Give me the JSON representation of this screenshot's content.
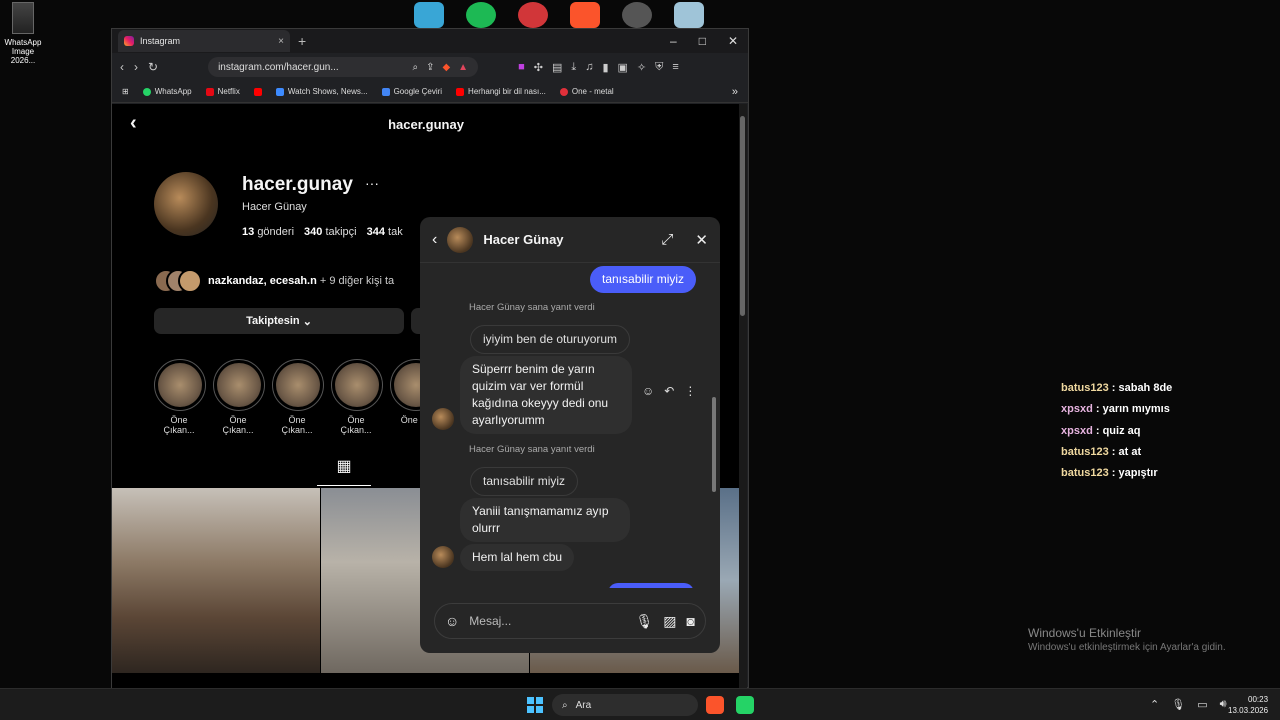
{
  "desktop": {
    "icon_label": "WhatsApp Image 2026..."
  },
  "browser": {
    "tab_title": "Instagram",
    "tab_close": "×",
    "new_tab": "+",
    "win_min": "–",
    "win_max": "□",
    "win_close": "✕",
    "url": "instagram.com/hacer.gun...",
    "bookmarks": [
      "WhatsApp",
      "Netflix",
      "Watch Shows, News...",
      "Google Çeviri",
      "Herhangi bir dil nası...",
      "One - metal"
    ],
    "bookmark_more": "»"
  },
  "profile": {
    "header_title": "hacer.gunay",
    "username": "hacer.gunay",
    "more": "···",
    "full_name": "Hacer Günay",
    "posts_count": "13",
    "posts_label": "gönderi",
    "followers_count": "340",
    "followers_label": "takipçi",
    "following_count": "344",
    "following_label": "tak",
    "followed_by_names": "nazkandaz, ecesah.n",
    "followed_by_rest": "+ 9 diğer kişi ta",
    "follow_button": "Takiptesin",
    "highlights": [
      "Öne Çıkan...",
      "Öne Çıkan...",
      "Öne Çıkan...",
      "Öne Çıkan...",
      "Öne Çı"
    ]
  },
  "chat": {
    "contact_name": "Hacer Günay",
    "messages": {
      "m1": "tanısabilir miyiz",
      "reply_meta_1": "Hacer Günay sana yanıt verdi",
      "quoted_1": "iyiyim ben de oturuyorum",
      "m2": "Süperrr benim de yarın quizim var ver formül kağıdına okeyyy dedi onu ayarlıyorumm",
      "reply_meta_2": "Hacer Günay sana yanıt verdi",
      "quoted_2": "tanısabilir miyiz",
      "m3": "Yaniii tanışmamamız ayıp olurrr",
      "m4": "Hem lal hem cbu"
    },
    "composer_placeholder": "Mesaj..."
  },
  "stream_chat": [
    {
      "user": "batus123",
      "text": "sabah 8de"
    },
    {
      "user": "xpsxd",
      "text": "yarın mıymıs"
    },
    {
      "user": "xpsxd",
      "text": "quiz aq"
    },
    {
      "user": "batus123",
      "text": "at at"
    },
    {
      "user": "batus123",
      "text": "yapıştır"
    }
  ],
  "watermark": {
    "title": "Windows'u Etkinleştir",
    "subtitle": "Windows'u etkinleştirmek için Ayarlar'a gidin."
  },
  "taskbar": {
    "search_label": "Ara",
    "time": "00:23",
    "date": "13.03.2026"
  },
  "colors": {
    "accent_bubble": "#4a5df9",
    "stream_user_1": "#f0d9a0",
    "stream_user_2": "#e7b4e0"
  }
}
